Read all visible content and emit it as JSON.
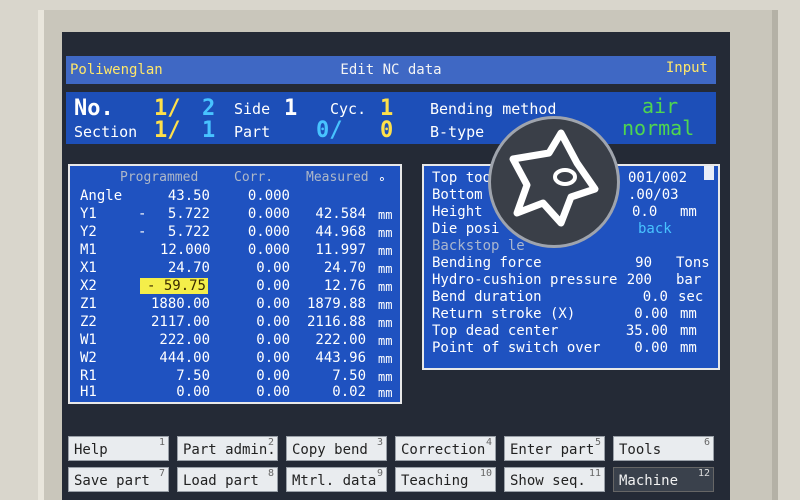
{
  "titlebar": {
    "left": "Poliwenglan",
    "center": "Edit NC data",
    "right": "Input"
  },
  "info": {
    "no_label": "No.",
    "no_value": "1/",
    "no_total": "2",
    "side_label": "Side",
    "side_value": "1",
    "cyc_label": "Cyc.",
    "cyc_value": "1",
    "section_label": "Section",
    "section_value": "1/",
    "section_total": "1",
    "part_label": "Part",
    "part_value": "0/",
    "part_total": "0",
    "bending_method_label": "Bending method",
    "bending_method_value": "air",
    "btype_label": "B-type",
    "btype_value": "normal"
  },
  "table": {
    "headers": {
      "programmed": "Programmed",
      "corr": "Corr.",
      "measured": "Measured",
      "degree": "°"
    },
    "rows": [
      {
        "axis": "Angle",
        "sign": "",
        "programmed": "43.50",
        "corr": "0.000",
        "measured": "",
        "unit": ""
      },
      {
        "axis": "Y1",
        "sign": "-",
        "programmed": "5.722",
        "corr": "0.000",
        "measured": "42.584",
        "unit": "mm"
      },
      {
        "axis": "Y2",
        "sign": "-",
        "programmed": "5.722",
        "corr": "0.000",
        "measured": "44.968",
        "unit": "mm"
      },
      {
        "axis": "M1",
        "sign": "",
        "programmed": "12.000",
        "corr": "0.000",
        "measured": "11.997",
        "unit": "mm"
      },
      {
        "axis": "X1",
        "sign": "",
        "programmed": "24.70",
        "corr": "0.00",
        "measured": "24.70",
        "unit": "mm"
      },
      {
        "axis": "X2",
        "sign": "",
        "programmed": "- 59.75",
        "corr": "0.00",
        "measured": "12.76",
        "unit": "mm"
      },
      {
        "axis": "Z1",
        "sign": "",
        "programmed": "1880.00",
        "corr": "0.00",
        "measured": "1879.88",
        "unit": "mm"
      },
      {
        "axis": "Z2",
        "sign": "",
        "programmed": "2117.00",
        "corr": "0.00",
        "measured": "2116.88",
        "unit": "mm"
      },
      {
        "axis": "W1",
        "sign": "",
        "programmed": "222.00",
        "corr": "0.00",
        "measured": "222.00",
        "unit": "mm"
      },
      {
        "axis": "W2",
        "sign": "",
        "programmed": "444.00",
        "corr": "0.00",
        "measured": "443.96",
        "unit": "mm"
      },
      {
        "axis": "R1",
        "sign": "",
        "programmed": "7.50",
        "corr": "0.00",
        "measured": "7.50",
        "unit": "mm"
      },
      {
        "axis": "H1",
        "sign": "",
        "programmed": "0.00",
        "corr": "0.00",
        "measured": "0.02",
        "unit": "mm"
      }
    ]
  },
  "params": [
    {
      "label": "Top too",
      "value": "001/002",
      "unit": ""
    },
    {
      "label": "Bottom",
      "value": ".00/03",
      "unit": ""
    },
    {
      "label": "Height",
      "value": "0.0",
      "unit": "mm"
    },
    {
      "label": "Die posi",
      "value": "back",
      "unit": ""
    },
    {
      "label": "Backstop le",
      "value": "",
      "unit": ""
    },
    {
      "label": "Bending force",
      "value": "90",
      "unit": "Tons"
    },
    {
      "label": "Hydro-cushion pressure",
      "value": "200",
      "unit": "bar"
    },
    {
      "label": "Bend duration",
      "value": "0.0",
      "unit": "sec"
    },
    {
      "label": "Return stroke (X)",
      "value": "0.00",
      "unit": "mm"
    },
    {
      "label": "Top dead center",
      "value": "35.00",
      "unit": "mm"
    },
    {
      "label": "Point of switch over",
      "value": "0.00",
      "unit": "mm"
    }
  ],
  "fkeys": [
    {
      "label": "Help",
      "num": "1"
    },
    {
      "label": "Part admin.",
      "num": "2"
    },
    {
      "label": "Copy bend",
      "num": "3"
    },
    {
      "label": "Correction",
      "num": "4"
    },
    {
      "label": "Enter part",
      "num": "5"
    },
    {
      "label": "Tools",
      "num": "6"
    },
    {
      "label": "Save part",
      "num": "7"
    },
    {
      "label": "Load part",
      "num": "8"
    },
    {
      "label": "Mtrl. data",
      "num": "9"
    },
    {
      "label": "Teaching",
      "num": "10"
    },
    {
      "label": "Show seq.",
      "num": "11"
    },
    {
      "label": "Machine",
      "num": "12"
    }
  ]
}
